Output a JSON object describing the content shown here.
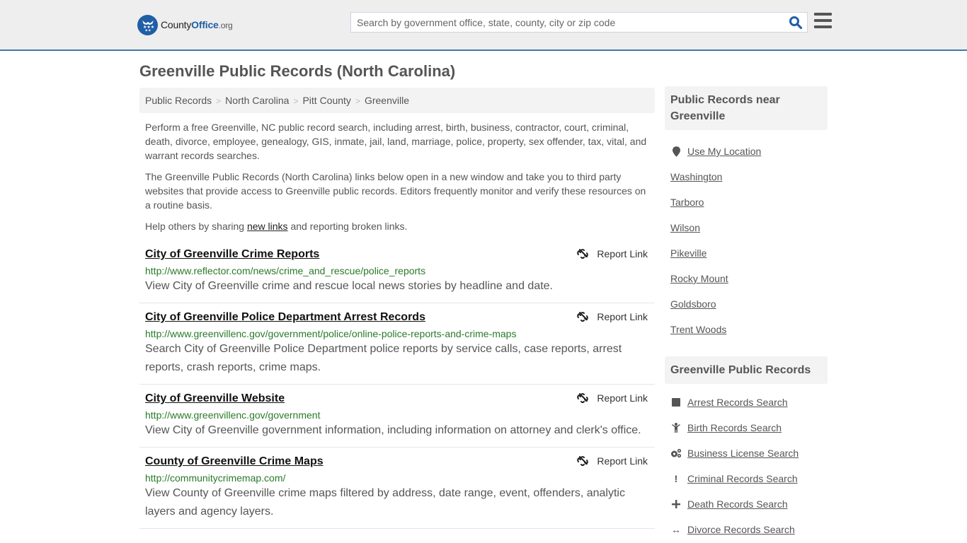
{
  "header": {
    "logo": {
      "name_part1": "County",
      "name_part2": "Office",
      "tld": ".org"
    },
    "search": {
      "placeholder": "Search by government office, state, county, city or zip code",
      "value": ""
    }
  },
  "page_title": "Greenville Public Records (North Carolina)",
  "breadcrumb": [
    "Public Records",
    "North Carolina",
    "Pitt County",
    "Greenville"
  ],
  "intro": {
    "p1": "Perform a free Greenville, NC public record search, including arrest, birth, business, contractor, court, criminal, death, divorce, employee, genealogy, GIS, inmate, jail, land, marriage, police, property, sex offender, tax, vital, and warrant records searches.",
    "p2": "The Greenville Public Records (North Carolina) links below open in a new window and take you to third party websites that provide access to Greenville public records. Editors frequently monitor and verify these resources on a routine basis.",
    "p3_before": "Help others by sharing ",
    "p3_link": "new links",
    "p3_after": " and reporting broken links."
  },
  "report_link_label": "Report Link",
  "records": [
    {
      "title": "City of Greenville Crime Reports",
      "url": "http://www.reflector.com/news/crime_and_rescue/police_reports",
      "description": "View City of Greenville crime and rescue local news stories by headline and date."
    },
    {
      "title": "City of Greenville Police Department Arrest Records",
      "url": "http://www.greenvillenc.gov/government/police/online-police-reports-and-crime-maps",
      "description": "Search City of Greenville Police Department police reports by service calls, case reports, arrest reports, crash reports, crime maps."
    },
    {
      "title": "City of Greenville Website",
      "url": "http://www.greenvillenc.gov/government",
      "description": "View City of Greenville government information, including information on attorney and clerk's office."
    },
    {
      "title": "County of Greenville Crime Maps",
      "url": "http://communitycrimemap.com/",
      "description": "View County of Greenville crime maps filtered by address, date range, event, offenders, analytic layers and agency layers."
    }
  ],
  "sidebar": {
    "nearby": {
      "heading": "Public Records near Greenville",
      "use_location": "Use My Location",
      "cities": [
        "Washington",
        "Tarboro",
        "Wilson",
        "Pikeville",
        "Rocky Mount",
        "Goldsboro",
        "Trent Woods"
      ]
    },
    "records": {
      "heading": "Greenville Public Records",
      "items": [
        {
          "label": "Arrest Records Search",
          "icon": "square-icon"
        },
        {
          "label": "Birth Records Search",
          "icon": "child-icon"
        },
        {
          "label": "Business License Search",
          "icon": "gears-icon"
        },
        {
          "label": "Criminal Records Search",
          "icon": "exclamation-icon"
        },
        {
          "label": "Death Records Search",
          "icon": "plus-icon"
        },
        {
          "label": "Divorce Records Search",
          "icon": "arrows-horizontal-icon"
        }
      ]
    }
  },
  "colors": {
    "brand_blue": "#1f5fa6",
    "header_border": "#3d7aab",
    "url_green": "#2a7a2a",
    "panel_gray": "#f3f3f3"
  }
}
